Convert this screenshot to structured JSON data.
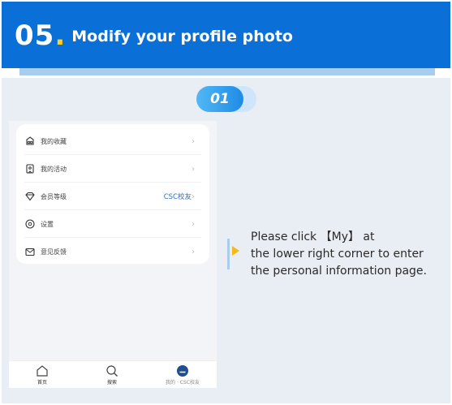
{
  "header": {
    "step_number": "05",
    "dot": ".",
    "title": "Modify your profile photo"
  },
  "step_badge": {
    "label": "01"
  },
  "phone": {
    "menu_items": [
      {
        "icon": "favorites-icon",
        "label": "我的收藏",
        "value": ""
      },
      {
        "icon": "activity-icon",
        "label": "我的活动",
        "value": ""
      },
      {
        "icon": "diamond-icon",
        "label": "会员等级",
        "value": "CSC校友"
      },
      {
        "icon": "settings-icon",
        "label": "设置",
        "value": ""
      },
      {
        "icon": "feedback-icon",
        "label": "意见反馈",
        "value": ""
      }
    ],
    "tabs": [
      {
        "icon": "home-icon",
        "label": "首页"
      },
      {
        "icon": "search-icon",
        "label": "搜索"
      },
      {
        "icon": "profile-icon",
        "label": "我的 · CSC校友"
      }
    ]
  },
  "instruction": {
    "lines": [
      "Please click 【My】 at",
      "the lower right corner to enter",
      "the personal information page."
    ]
  },
  "colors": {
    "banner": "#0a6fd6",
    "accent_dot": "#ffd11a",
    "content_bg": "#e9edf4",
    "callout_triangle": "#f5b91a",
    "member_value": "#2b6fc7"
  }
}
